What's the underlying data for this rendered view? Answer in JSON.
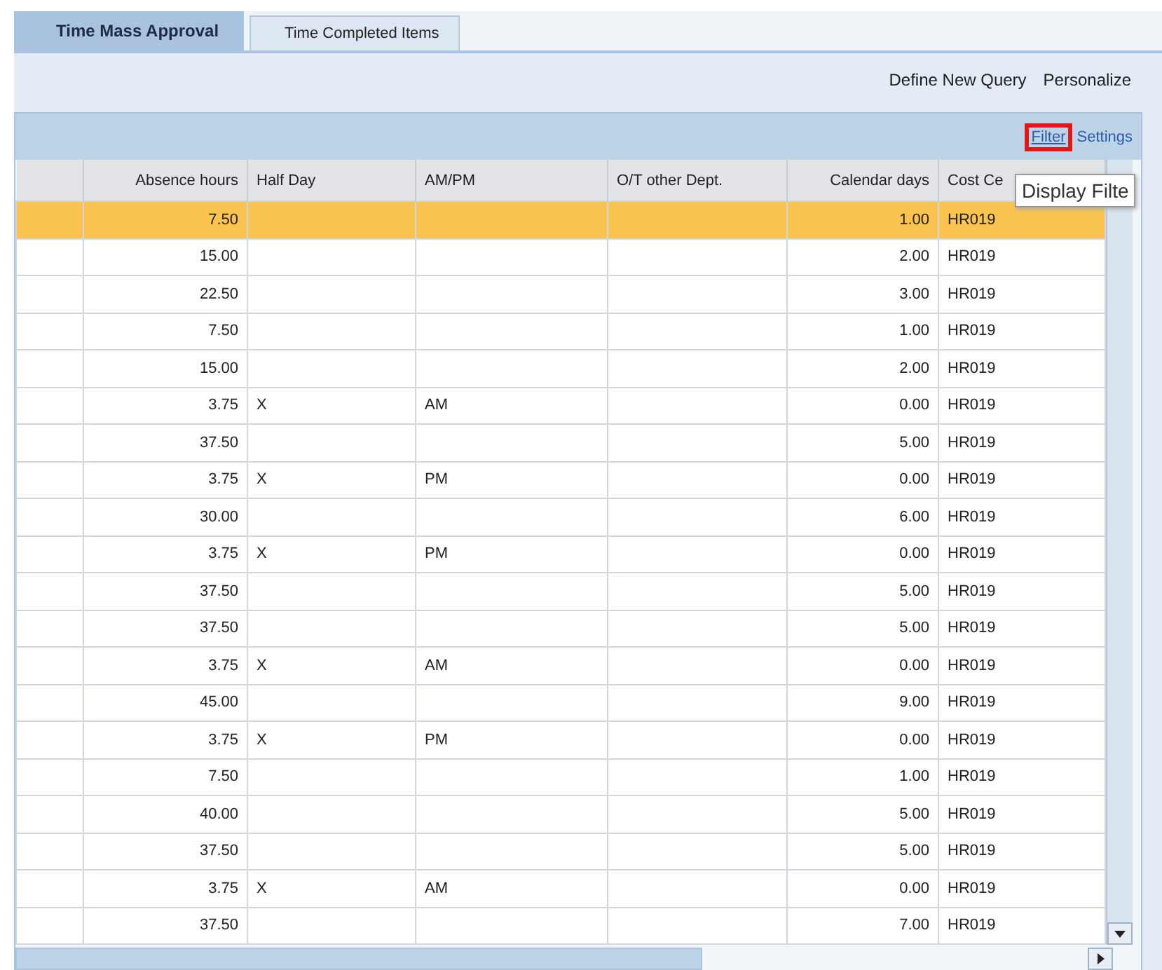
{
  "tabs": [
    {
      "label": "Time Mass Approval",
      "selected": true
    },
    {
      "label": "Time Completed Items",
      "selected": false
    }
  ],
  "toolbar_links": [
    "Define New Query",
    "Personalize"
  ],
  "table_toolbar": {
    "filter": "Filter",
    "settings": "Settings",
    "tooltip": "Display Filte"
  },
  "table": {
    "columns": [
      "",
      "Absence hours",
      "Half Day",
      "AM/PM",
      "O/T other Dept.",
      "Calendar days",
      "Cost Ce"
    ],
    "rows": [
      {
        "selected": true,
        "cells": [
          "",
          "7.50",
          "",
          "",
          "",
          "1.00",
          "HR019"
        ]
      },
      {
        "selected": false,
        "cells": [
          "",
          "15.00",
          "",
          "",
          "",
          "2.00",
          "HR019"
        ]
      },
      {
        "selected": false,
        "cells": [
          "",
          "22.50",
          "",
          "",
          "",
          "3.00",
          "HR019"
        ]
      },
      {
        "selected": false,
        "cells": [
          "",
          "7.50",
          "",
          "",
          "",
          "1.00",
          "HR019"
        ]
      },
      {
        "selected": false,
        "cells": [
          "",
          "15.00",
          "",
          "",
          "",
          "2.00",
          "HR019"
        ]
      },
      {
        "selected": false,
        "cells": [
          "",
          "3.75",
          "X",
          "AM",
          "",
          "0.00",
          "HR019"
        ]
      },
      {
        "selected": false,
        "cells": [
          "",
          "37.50",
          "",
          "",
          "",
          "5.00",
          "HR019"
        ]
      },
      {
        "selected": false,
        "cells": [
          "",
          "3.75",
          "X",
          "PM",
          "",
          "0.00",
          "HR019"
        ]
      },
      {
        "selected": false,
        "cells": [
          "",
          "30.00",
          "",
          "",
          "",
          "6.00",
          "HR019"
        ]
      },
      {
        "selected": false,
        "cells": [
          "",
          "3.75",
          "X",
          "PM",
          "",
          "0.00",
          "HR019"
        ]
      },
      {
        "selected": false,
        "cells": [
          "",
          "37.50",
          "",
          "",
          "",
          "5.00",
          "HR019"
        ]
      },
      {
        "selected": false,
        "cells": [
          "",
          "37.50",
          "",
          "",
          "",
          "5.00",
          "HR019"
        ]
      },
      {
        "selected": false,
        "cells": [
          "",
          "3.75",
          "X",
          "AM",
          "",
          "0.00",
          "HR019"
        ]
      },
      {
        "selected": false,
        "cells": [
          "",
          "45.00",
          "",
          "",
          "",
          "9.00",
          "HR019"
        ]
      },
      {
        "selected": false,
        "cells": [
          "",
          "3.75",
          "X",
          "PM",
          "",
          "0.00",
          "HR019"
        ]
      },
      {
        "selected": false,
        "cells": [
          "",
          "7.50",
          "",
          "",
          "",
          "1.00",
          "HR019"
        ]
      },
      {
        "selected": false,
        "cells": [
          "",
          "40.00",
          "",
          "",
          "",
          "5.00",
          "HR019"
        ]
      },
      {
        "selected": false,
        "cells": [
          "",
          "37.50",
          "",
          "",
          "",
          "5.00",
          "HR019"
        ]
      },
      {
        "selected": false,
        "cells": [
          "",
          "3.75",
          "X",
          "AM",
          "",
          "0.00",
          "HR019"
        ]
      },
      {
        "selected": false,
        "cells": [
          "",
          "37.50",
          "",
          "",
          "",
          "7.00",
          "HR019"
        ]
      }
    ]
  }
}
